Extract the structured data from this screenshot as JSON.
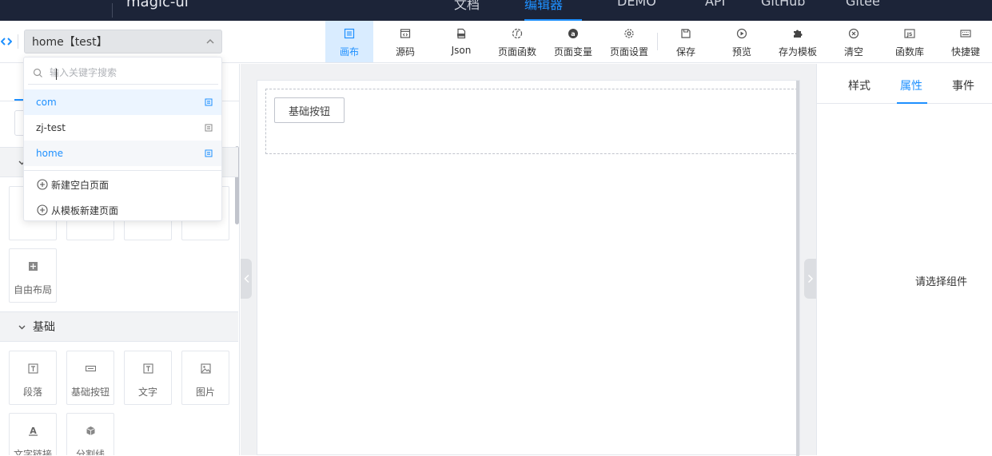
{
  "topbar": {
    "logo": "",
    "brand": "magic-ui",
    "nav": [
      {
        "label": "文档",
        "active": false
      },
      {
        "label": "编辑器",
        "active": true
      },
      {
        "label": "DEMO",
        "active": false
      },
      {
        "label": "API",
        "active": false
      },
      {
        "label": "GitHub",
        "active": false
      },
      {
        "label": "Gitee",
        "active": false
      }
    ]
  },
  "page_selector": {
    "value": "home【test】"
  },
  "toolbar": [
    {
      "label": "画布",
      "icon": "canvas-icon",
      "active": true
    },
    {
      "label": "源码",
      "icon": "source-code-icon",
      "active": false
    },
    {
      "label": "Json",
      "icon": "json-file-icon",
      "active": false
    },
    {
      "label": "页面函数",
      "icon": "function-icon",
      "active": false
    },
    {
      "label": "页面变量",
      "icon": "variable-icon",
      "active": false
    },
    {
      "label": "页面设置",
      "icon": "gear-icon",
      "active": false
    },
    {
      "label": "保存",
      "icon": "save-icon",
      "active": false
    },
    {
      "label": "预览",
      "icon": "play-icon",
      "active": false
    },
    {
      "label": "存为模板",
      "icon": "puzzle-icon",
      "active": false
    },
    {
      "label": "清空",
      "icon": "clear-icon",
      "active": false
    },
    {
      "label": "函数库",
      "icon": "js-library-icon",
      "active": false
    },
    {
      "label": "快捷键",
      "icon": "keyboard-icon",
      "active": false
    }
  ],
  "dropdown": {
    "search_placeholder": "输入关键字搜索",
    "items": [
      {
        "label": "com",
        "state": "hover"
      },
      {
        "label": "zj-test",
        "state": "normal"
      },
      {
        "label": "home",
        "state": "selected"
      }
    ],
    "actions": [
      {
        "label": "新建空白页面",
        "icon": "plus-circle-icon"
      },
      {
        "label": "从模板新建页面",
        "icon": "plus-circle-icon"
      }
    ]
  },
  "left_panel": {
    "layout_group": {
      "components_hidden_row": [
        "",
        "",
        "",
        ""
      ],
      "components": [
        {
          "label": "自由布局",
          "icon": "free-layout-icon"
        }
      ]
    },
    "basic_group": {
      "title": "基础",
      "components": [
        {
          "label": "段落",
          "icon": "paragraph-icon"
        },
        {
          "label": "基础按钮",
          "icon": "button-icon"
        },
        {
          "label": "文字",
          "icon": "text-icon"
        },
        {
          "label": "图片",
          "icon": "image-icon"
        },
        {
          "label": "文字链接",
          "icon": "text-link-icon"
        },
        {
          "label": "分割线",
          "icon": "divider-icon"
        }
      ]
    }
  },
  "canvas": {
    "button_label": "基础按钮"
  },
  "right_panel": {
    "tabs": [
      {
        "label": "样式",
        "active": false
      },
      {
        "label": "属性",
        "active": true
      },
      {
        "label": "事件",
        "active": false
      }
    ],
    "empty_text": "请选择组件"
  },
  "colors": {
    "accent": "#1e90ff",
    "topbar_bg": "#1c2438",
    "active_tool_bg": "#d9ecff"
  }
}
